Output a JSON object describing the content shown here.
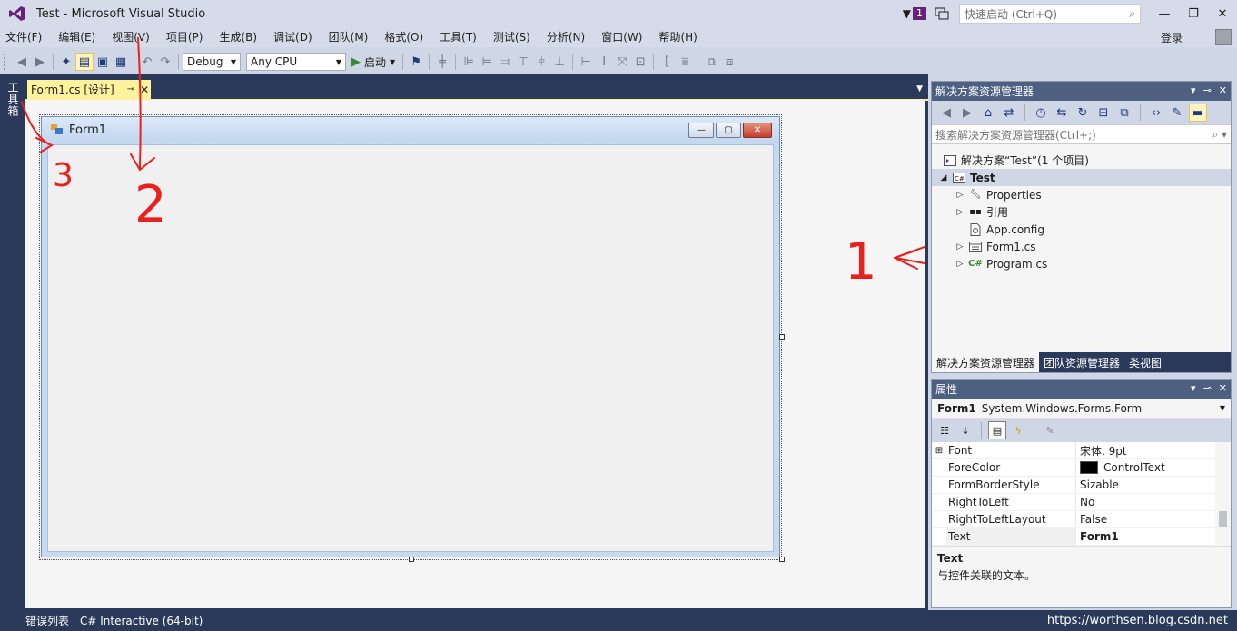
{
  "window": {
    "title": "Test - Microsoft Visual Studio",
    "notification_count": "1",
    "quick_launch_placeholder": "快速启动 (Ctrl+Q)",
    "minimize": "—",
    "maximize": "❐",
    "close": "✕"
  },
  "menu": {
    "items": [
      "文件(F)",
      "编辑(E)",
      "视图(V)",
      "项目(P)",
      "生成(B)",
      "调试(D)",
      "团队(M)",
      "格式(O)",
      "工具(T)",
      "测试(S)",
      "分析(N)",
      "窗口(W)",
      "帮助(H)"
    ],
    "login": "登录"
  },
  "toolbar": {
    "config": "Debug",
    "platform": "Any CPU",
    "start_label": "启动"
  },
  "toolbox": {
    "label": "工具箱"
  },
  "document": {
    "tab_label": "Form1.cs [设计]",
    "pin": "⊸",
    "close": "✕"
  },
  "form": {
    "title": "Form1",
    "minimize": "—",
    "maximize": "▢",
    "close": "✕"
  },
  "solution_explorer": {
    "title": "解决方案资源管理器",
    "search_placeholder": "搜索解决方案资源管理器(Ctrl+;)",
    "tree": [
      {
        "label": "解决方案“Test”(1 个项目)",
        "icon": "solution-icon"
      },
      {
        "label": "Test",
        "icon": "csharp-project-icon"
      },
      {
        "label": "Properties",
        "icon": "wrench-icon"
      },
      {
        "label": "引用",
        "icon": "references-icon"
      },
      {
        "label": "App.config",
        "icon": "config-file-icon"
      },
      {
        "label": "Form1.cs",
        "icon": "form-file-icon"
      },
      {
        "label": "Program.cs",
        "icon": "csharp-file-icon"
      }
    ],
    "bottom_tabs": [
      "解决方案资源管理器",
      "团队资源管理器",
      "类视图"
    ]
  },
  "properties": {
    "title": "属性",
    "object_name": "Form1",
    "object_type": "System.Windows.Forms.Form",
    "rows": [
      {
        "name": "Font",
        "value": "宋体, 9pt",
        "expandable": "⊞"
      },
      {
        "name": "ForeColor",
        "value": "ControlText",
        "swatch": "#000000"
      },
      {
        "name": "FormBorderStyle",
        "value": "Sizable"
      },
      {
        "name": "RightToLeft",
        "value": "No"
      },
      {
        "name": "RightToLeftLayout",
        "value": "False"
      },
      {
        "name": "Text",
        "value": "Form1"
      }
    ],
    "desc_title": "Text",
    "desc_text": "与控件关联的文本。"
  },
  "statusbar": {
    "items": [
      "错误列表",
      "C# Interactive (64-bit)"
    ],
    "watermark": "https://worthsen.blog.csdn.net"
  },
  "annotations": [
    "1",
    "2",
    "3"
  ],
  "colors": {
    "accent": "#68217a",
    "tab_active": "#fff29d",
    "panel_title": "#4d6082",
    "dark_chrome": "#2b3a5a",
    "annotation": "#e8201e"
  }
}
